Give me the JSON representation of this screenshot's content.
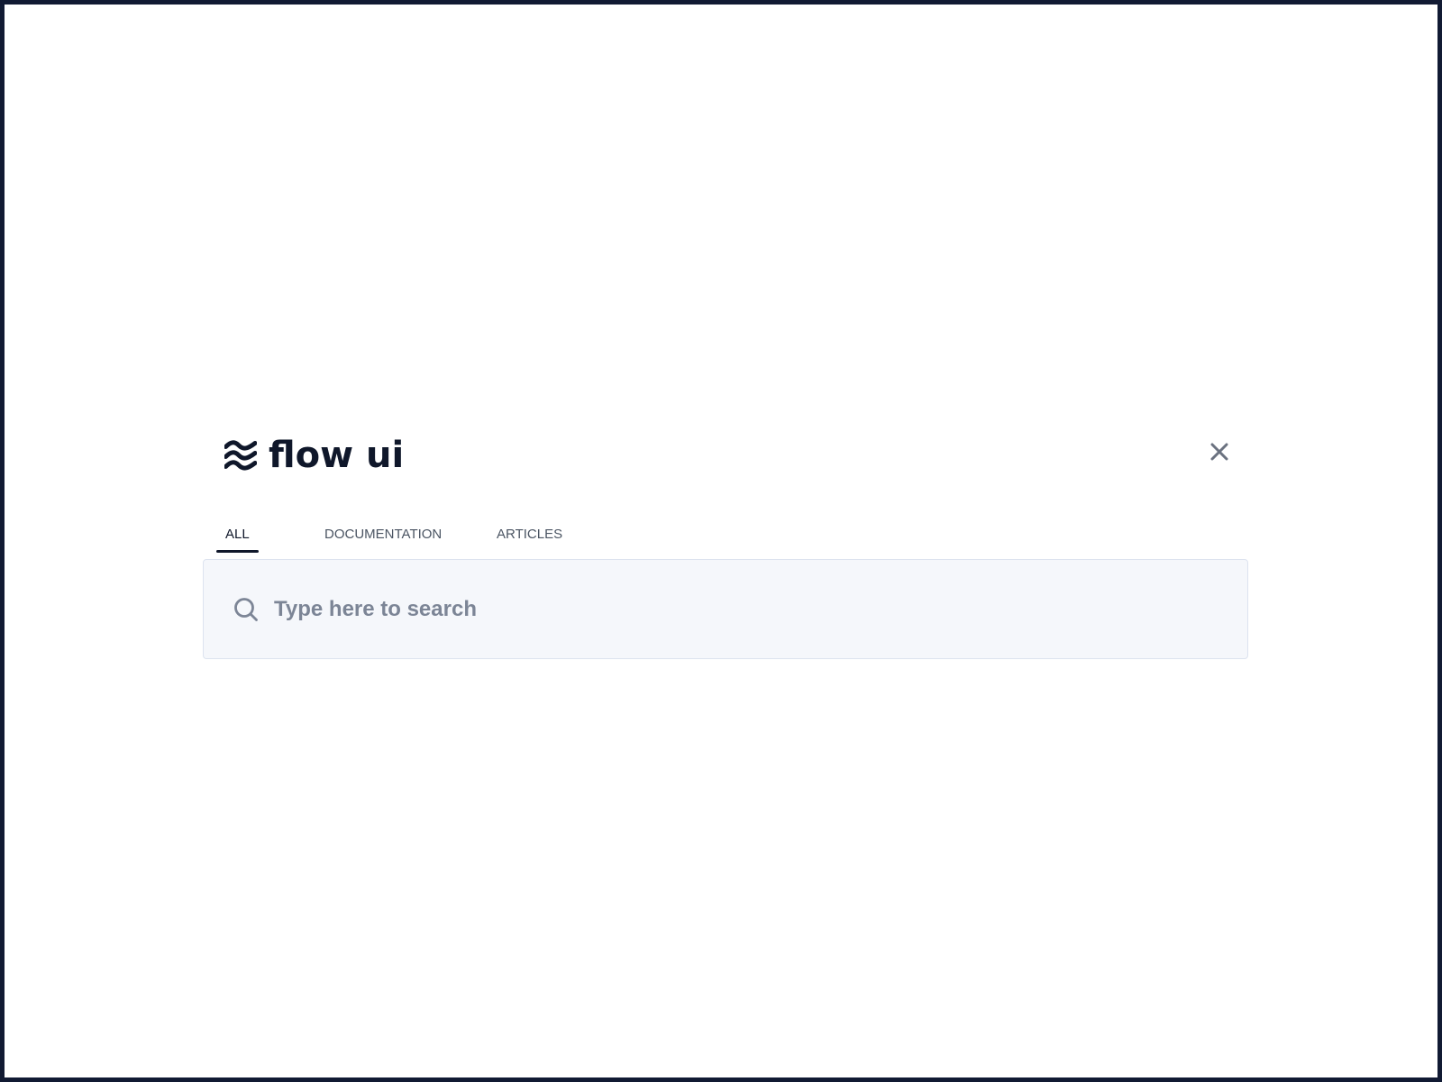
{
  "brand": {
    "title": "flow ui",
    "logo_icon": "wave-logo-icon"
  },
  "close": {
    "icon": "close-icon"
  },
  "tabs": [
    {
      "label": "ALL",
      "active": true
    },
    {
      "label": "DOCUMENTATION",
      "active": false
    },
    {
      "label": "ARTICLES",
      "active": false
    }
  ],
  "search": {
    "icon": "search-icon",
    "placeholder": "Type here to search",
    "value": ""
  },
  "colors": {
    "frame": "#111a33",
    "text_primary": "#0f172a",
    "tab_inactive": "#4b5563",
    "search_background": "#f5f7fb",
    "search_border": "#dde3ef",
    "placeholder": "#7c8596",
    "close_icon": "#6b7280"
  }
}
